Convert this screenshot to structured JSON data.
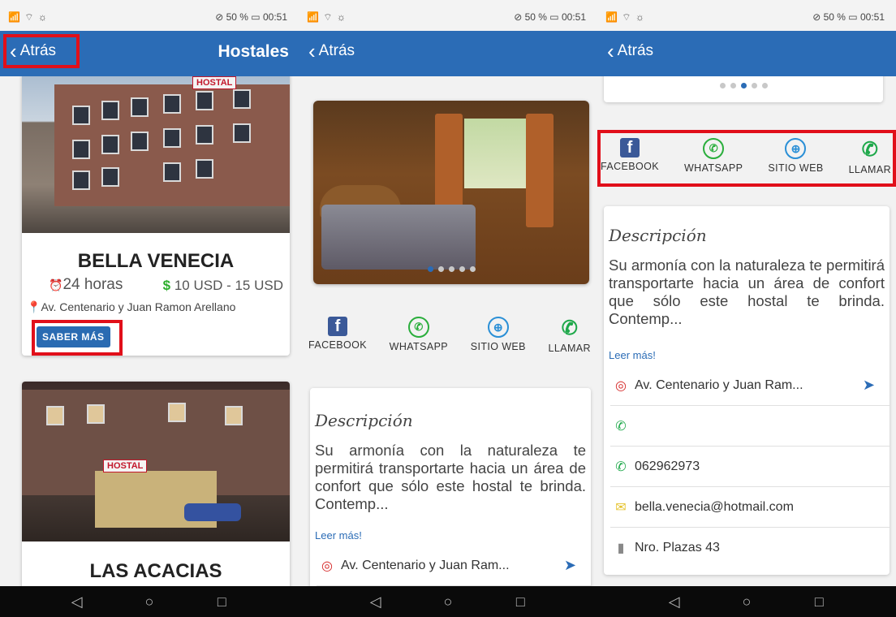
{
  "status": {
    "left_icons": "📶 ⌔ ☼",
    "right": "⊘ 50 % ▭ 00:51"
  },
  "appbar": {
    "back_label": "Atrás",
    "title": "Hostales",
    "color": "#2b6cb6"
  },
  "list": {
    "cards": [
      {
        "sign": "HOSTAL",
        "title": "BELLA VENECIA",
        "hours": "24 horas",
        "price": "10 USD - 15 USD",
        "address": "Av. Centenario y Juan Ramon Arellano",
        "button": "SABER MÁS"
      },
      {
        "sign": "HOSTAL",
        "title": "LAS ACACIAS"
      }
    ]
  },
  "detail": {
    "social": [
      {
        "label": "FACEBOOK",
        "icon": "facebook-icon"
      },
      {
        "label": "WHATSAPP",
        "icon": "whatsapp-icon"
      },
      {
        "label": "SITIO WEB",
        "icon": "globe-icon"
      },
      {
        "label": "LLAMAR",
        "icon": "phone-icon"
      }
    ],
    "desc_title": "Descripción",
    "desc_text": "Su armonía con la naturaleza te permitirá transportarte hacia un área de confort que sólo este hostal te brinda. Contemp...",
    "read_more": "Leer más!",
    "address": "Av. Centenario y Juan Ram...",
    "phone_empty": "",
    "phone": "062962973",
    "email": "bella.venecia@hotmail.com",
    "plazas": "Nro. Plazas 43"
  },
  "nav": {
    "back": "◁",
    "home": "○",
    "recent": "□"
  },
  "highlight_color": "#e10f1a"
}
